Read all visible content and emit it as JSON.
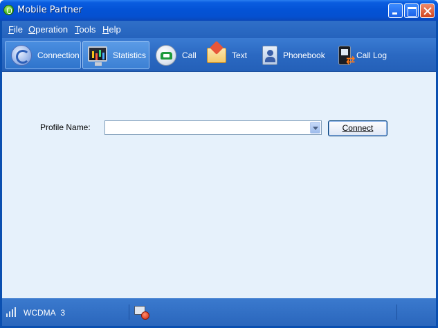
{
  "window": {
    "title": "Mobile Partner",
    "icon": "mobile-partner-icon",
    "buttons": [
      "minimize",
      "maximize",
      "close"
    ]
  },
  "menu": {
    "items": [
      {
        "label": "File",
        "mnemonic": "F",
        "rest": "ile"
      },
      {
        "label": "Operation",
        "mnemonic": "O",
        "rest": "peration"
      },
      {
        "label": "Tools",
        "mnemonic": "T",
        "rest": "ools"
      },
      {
        "label": "Help",
        "mnemonic": "H",
        "rest": "elp"
      }
    ]
  },
  "toolbar": {
    "items": [
      {
        "label": "Connection",
        "icon": "connection-icon",
        "state": "active"
      },
      {
        "label": "Statistics",
        "icon": "statistics-icon",
        "state": "hover"
      },
      {
        "label": "Call",
        "icon": "call-icon",
        "state": "normal"
      },
      {
        "label": "Text",
        "icon": "text-message-icon",
        "state": "normal"
      },
      {
        "label": "Phonebook",
        "icon": "phonebook-icon",
        "state": "normal"
      },
      {
        "label": "Call Log",
        "icon": "call-log-icon",
        "state": "normal"
      }
    ]
  },
  "connection": {
    "profile_label": "Profile Name:",
    "profile_value": "",
    "connect_label": "Connect"
  },
  "status": {
    "network": "WCDMA",
    "signal_level": "3",
    "signal_icon": "signal-strength-icon",
    "sms_icon": "sms-status-icon"
  },
  "colors": {
    "titlebar": "#0453d6",
    "toolbar": "#2b69c2",
    "content_bg": "#e6f1fb",
    "statusbar": "#2f6ec4"
  }
}
